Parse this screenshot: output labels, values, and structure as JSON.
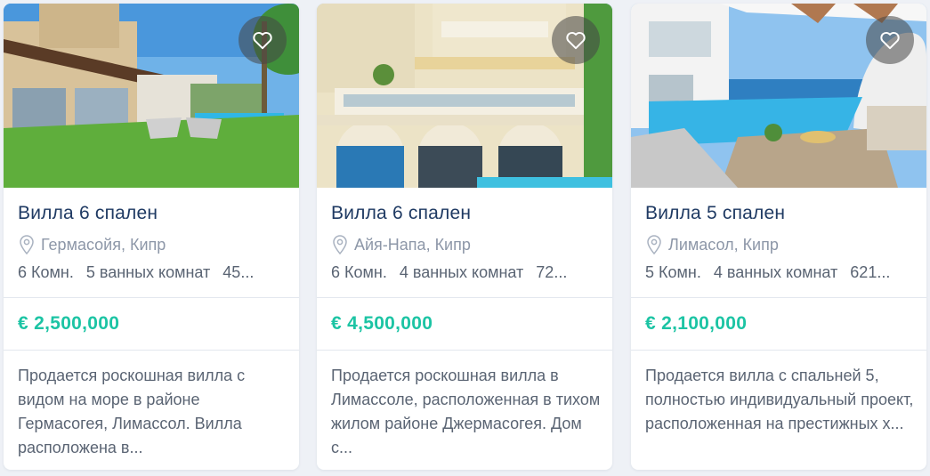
{
  "listings": [
    {
      "title": "Вилла 6 спален",
      "location": "Гермасойя, Кипр",
      "rooms": "6 Комн.",
      "baths": "5 ванных комнат",
      "area": "45...",
      "price": "€ 2,500,000",
      "desc": "Продается роскошная вилла с видом на море в районе Гермасогея, Лимассол. Вилла расположена в...",
      "icons": {
        "favorite": "heart-icon",
        "location": "map-pin-icon"
      }
    },
    {
      "title": "Вилла 6 спален",
      "location": "Айя-Напа, Кипр",
      "rooms": "6 Комн.",
      "baths": "4 ванных комнат",
      "area": "72...",
      "price": "€ 4,500,000",
      "desc": "Продается роскошная вилла в Лимассоле, расположенная в тихом жилом районе Джермасогея. Дом с...",
      "icons": {
        "favorite": "heart-icon",
        "location": "map-pin-icon"
      }
    },
    {
      "title": "Вилла 5 спален",
      "location": "Лимасол, Кипр",
      "rooms": "5 Комн.",
      "baths": "4 ванных комнат",
      "area": "621...",
      "price": "€ 2,100,000",
      "desc": "Продается вилла с спальней 5, полностью индивидуальный проект, расположенная на престижных х...",
      "icons": {
        "favorite": "heart-icon",
        "location": "map-pin-icon"
      }
    }
  ],
  "colors": {
    "title": "#1f3a63",
    "price": "#1cc4a4",
    "muted": "#8d97a8",
    "text": "#5a6473",
    "background": "#eef1f6"
  }
}
